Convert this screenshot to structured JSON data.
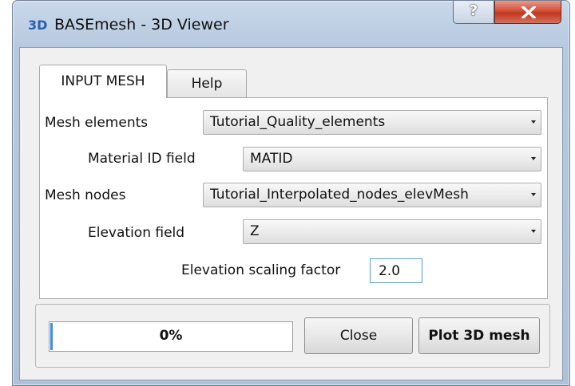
{
  "window": {
    "icon_text": "3D",
    "title": "BASEmesh - 3D Viewer",
    "help_glyph": "?"
  },
  "tabs": [
    {
      "label": "INPUT MESH",
      "active": true
    },
    {
      "label": "Help",
      "active": false
    }
  ],
  "form": {
    "mesh_elements": {
      "label": "Mesh elements",
      "value": "Tutorial_Quality_elements"
    },
    "material_id_field": {
      "label": "Material ID field",
      "value": "MATID"
    },
    "mesh_nodes": {
      "label": "Mesh nodes",
      "value": "Tutorial_Interpolated_nodes_elevMesh"
    },
    "elevation_field": {
      "label": "Elevation field",
      "value": "Z"
    },
    "elevation_scaling": {
      "label": "Elevation scaling factor",
      "value": "2.0"
    }
  },
  "progress": {
    "text": "0%",
    "value": 0
  },
  "buttons": {
    "close_label": "Close",
    "plot_label": "Plot 3D mesh"
  },
  "colors": {
    "title_close_button": "#c2361f",
    "progress_accent": "#3c8de0",
    "input_focus_border": "#5b9bd5"
  }
}
